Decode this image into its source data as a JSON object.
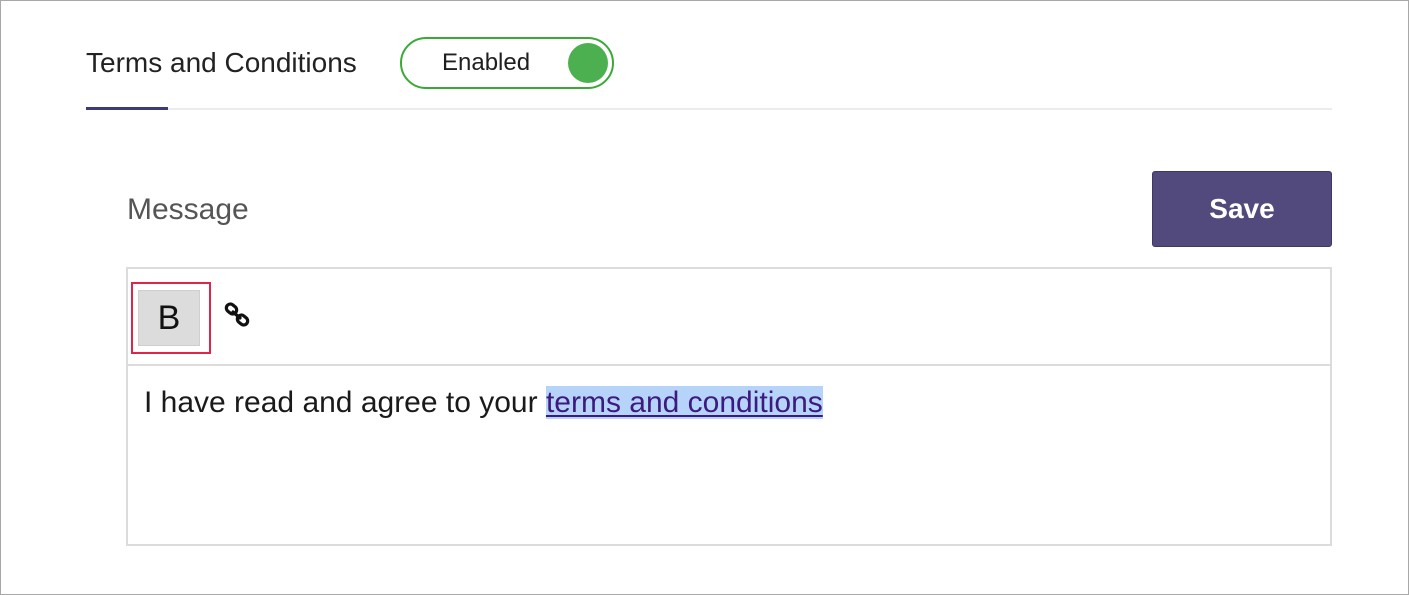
{
  "header": {
    "tab_label": "Terms and Conditions",
    "toggle": {
      "label": "Enabled",
      "state": "on",
      "accent_color": "#4caf50"
    }
  },
  "message": {
    "title": "Message",
    "save_label": "Save",
    "save_color": "#524a7d"
  },
  "editor": {
    "toolbar": {
      "bold_label": "B",
      "link_icon": "link-icon",
      "active_item": "bold"
    },
    "content": {
      "plain_text": "I have read and agree to your ",
      "link_text": "terms and conditions"
    }
  }
}
